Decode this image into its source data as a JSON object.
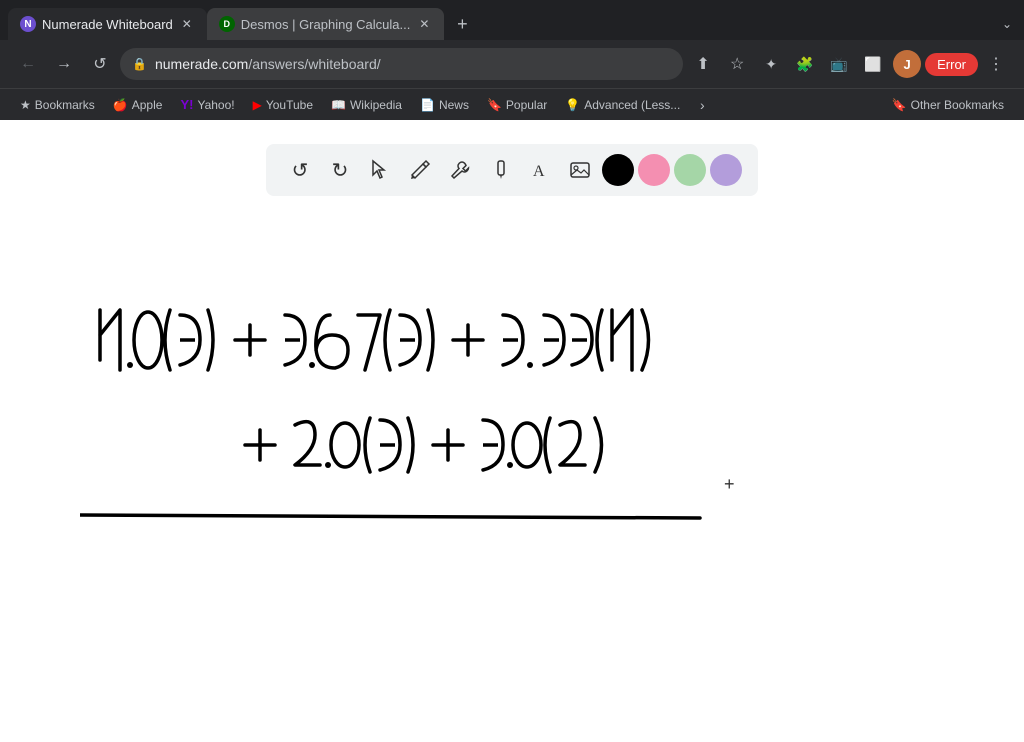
{
  "browser": {
    "tabs": [
      {
        "id": "numerade",
        "label": "Numerade Whiteboard",
        "icon": "N",
        "iconBg": "#6c4fcf",
        "active": true
      },
      {
        "id": "desmos",
        "label": "Desmos | Graphing Calcula...",
        "icon": "D",
        "iconBg": "#006400",
        "active": false
      }
    ],
    "new_tab_label": "+",
    "tab_menu_label": "⌄",
    "nav": {
      "back": "←",
      "forward": "→",
      "reload": "↺",
      "url": "numerade.com",
      "url_path": "/answers/whiteboard/",
      "share": "⬆",
      "bookmark": "☆",
      "extension1": "✦",
      "extension2": "🧩",
      "cast": "⬛",
      "split": "⬜",
      "profile_initial": "J",
      "error_label": "Error",
      "menu": "⋮"
    },
    "bookmarks": [
      {
        "id": "bookmarks",
        "label": "Bookmarks",
        "icon": "★"
      },
      {
        "id": "apple",
        "label": "Apple",
        "icon": "🍎"
      },
      {
        "id": "yahoo",
        "label": "Yahoo!",
        "icon": "Y"
      },
      {
        "id": "youtube",
        "label": "YouTube",
        "icon": "▶"
      },
      {
        "id": "wikipedia",
        "label": "Wikipedia",
        "icon": "W"
      },
      {
        "id": "news",
        "label": "News",
        "icon": "📄"
      },
      {
        "id": "popular",
        "label": "Popular",
        "icon": "🔖"
      },
      {
        "id": "advanced",
        "label": "Advanced (Less...",
        "icon": "💡"
      }
    ],
    "bookmarks_more": "›",
    "other_bookmarks_label": "Other Bookmarks",
    "other_bookmarks_icon": "🔖"
  },
  "toolbar": {
    "undo_label": "↺",
    "redo_label": "↻",
    "select_label": "⬆",
    "pencil_label": "✏",
    "tools_label": "⚙",
    "marker_label": "✒",
    "text_label": "A",
    "image_label": "🖼",
    "colors": [
      {
        "id": "black",
        "value": "#000000"
      },
      {
        "id": "pink",
        "value": "#F48FB1"
      },
      {
        "id": "green",
        "value": "#A5D6A7"
      },
      {
        "id": "purple",
        "value": "#B39DDB"
      }
    ]
  },
  "canvas": {
    "plus_symbol": "+"
  }
}
